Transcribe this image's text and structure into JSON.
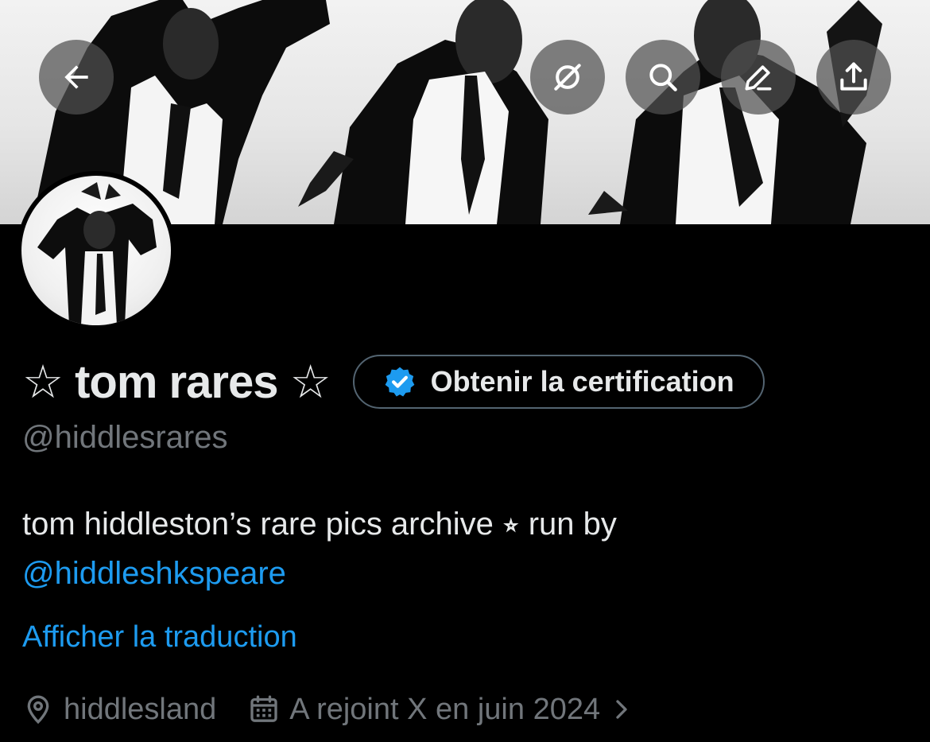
{
  "header": {
    "back_icon": "arrow-left-icon",
    "grok_icon": "grok-icon",
    "search_icon": "search-icon",
    "edit_icon": "edit-icon",
    "share_icon": "share-icon"
  },
  "profile": {
    "display_name": "☆ tom rares ☆",
    "handle": "@hiddlesrares",
    "verify_button_label": "Obtenir la certification",
    "verify_icon": "verified-badge-icon",
    "bio_text": "tom hiddleston’s rare pics archive ⭒ run by",
    "bio_mention": "@hiddleshkspeare",
    "translate_label": "Afficher la traduction",
    "location": "hiddlesland",
    "joined": "A rejoint X en juin 2024"
  },
  "colors": {
    "background": "#000000",
    "text": "#e7e9ea",
    "muted": "#71767b",
    "link": "#1d9bf0",
    "verified_blue": "#1d9bf0"
  }
}
